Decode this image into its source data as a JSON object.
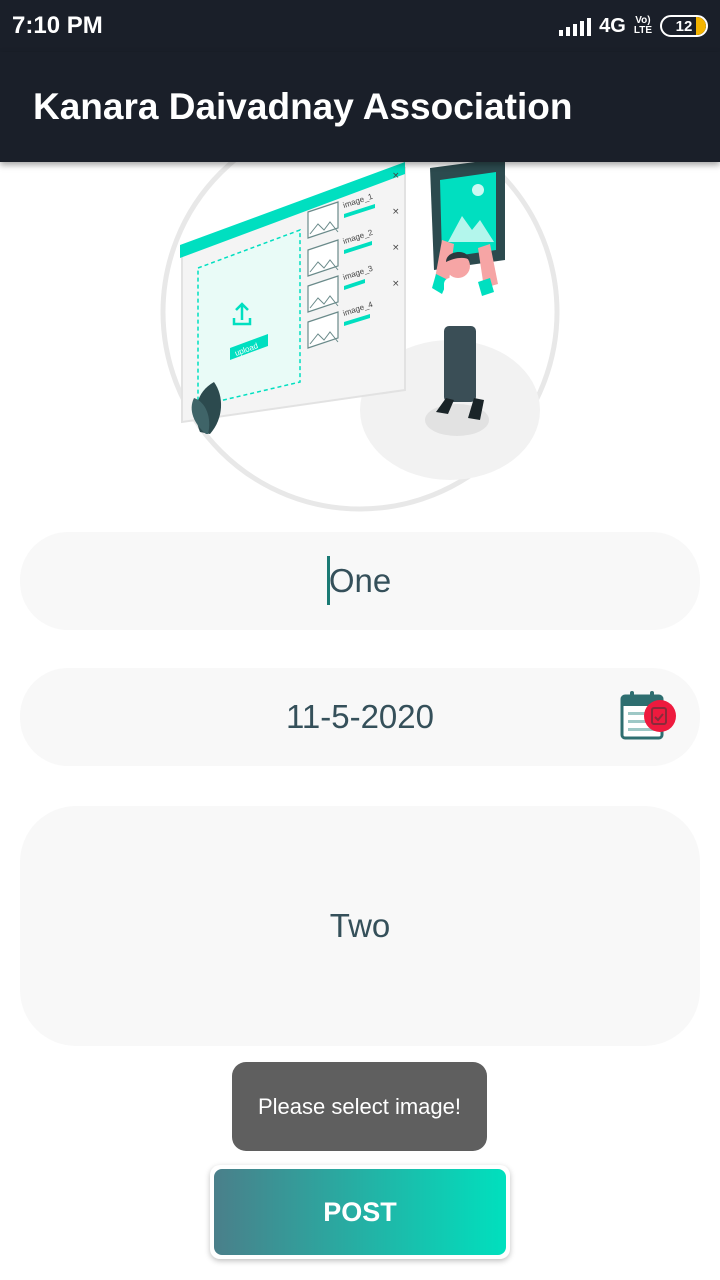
{
  "status_bar": {
    "time": "7:10 PM",
    "network": "4G",
    "volte_top": "Vo)",
    "volte_bottom": "LTE",
    "battery": "12"
  },
  "app_bar": {
    "title": "Kanara Daivadnay Association"
  },
  "illustration": {
    "upload_label": "upload",
    "images": [
      "image_1",
      "image_2",
      "image_3",
      "image_4"
    ]
  },
  "form": {
    "title_value": "One",
    "date_value": "11-5-2020",
    "description_value": "Two"
  },
  "toast": {
    "message": "Please select image!"
  },
  "post_button": {
    "label": "POST"
  },
  "colors": {
    "app_bar": "#1a1f29",
    "accent": "#00e0be",
    "field_bg": "#f8f8f8",
    "text": "#35505a"
  }
}
